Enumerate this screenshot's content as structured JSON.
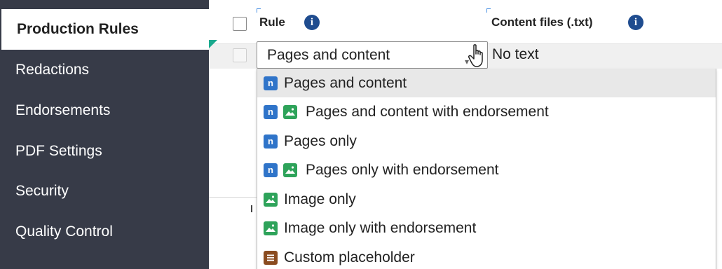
{
  "sidebar": {
    "items": [
      {
        "label": "Production Rules",
        "active": true
      },
      {
        "label": "Redactions"
      },
      {
        "label": "Endorsements"
      },
      {
        "label": "PDF Settings"
      },
      {
        "label": "Security"
      },
      {
        "label": "Quality Control"
      }
    ]
  },
  "header": {
    "rule_label": "Rule",
    "content_label": "Content files (.txt)",
    "info_glyph": "i"
  },
  "row": {
    "selected_value": "Pages and content",
    "content_value": "No text"
  },
  "dropdown": {
    "options": [
      {
        "label": "Pages and content",
        "icons": [
          "n-icon"
        ],
        "highlighted": true
      },
      {
        "label": "Pages and content with endorsement",
        "icons": [
          "n-icon",
          "image-icon"
        ]
      },
      {
        "label": "Pages only",
        "icons": [
          "n-icon"
        ]
      },
      {
        "label": "Pages only with endorsement",
        "icons": [
          "n-icon",
          "image-icon"
        ]
      },
      {
        "label": "Image only",
        "icons": [
          "image-icon"
        ]
      },
      {
        "label": "Image only with endorsement",
        "icons": [
          "image-icon"
        ]
      },
      {
        "label": "Custom placeholder",
        "icons": [
          "document-icon"
        ]
      }
    ],
    "badge_n_glyph": "n"
  },
  "colors": {
    "sidebar_bg": "#373b48",
    "info_icon": "#1f4c8f",
    "badge_n": "#2f74c9",
    "badge_image": "#2ea35a",
    "badge_document": "#8a4b1f",
    "accent_triangle": "#1aa98e"
  }
}
